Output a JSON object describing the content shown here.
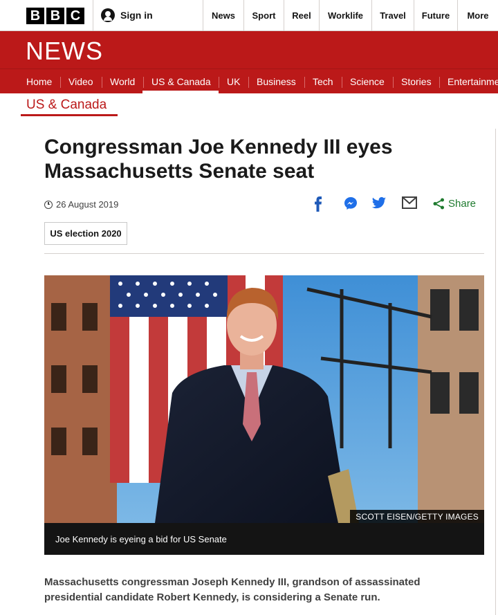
{
  "brand": {
    "letters": [
      "B",
      "B",
      "C"
    ]
  },
  "account": {
    "sign_in_label": "Sign in",
    "icon": "user-icon"
  },
  "top_nav": [
    "News",
    "Sport",
    "Reel",
    "Worklife",
    "Travel",
    "Future",
    "More"
  ],
  "news_banner": {
    "title": "NEWS",
    "color": "#bb1919"
  },
  "sub_nav": {
    "items": [
      "Home",
      "Video",
      "World",
      "US & Canada",
      "UK",
      "Business",
      "Tech",
      "Science",
      "Stories",
      "Entertainme"
    ],
    "active": "US & Canada"
  },
  "section": {
    "label": "US & Canada"
  },
  "article": {
    "headline_line1": "Congressman Joe Kennedy III eyes",
    "headline_line2": "Massachusetts Senate seat",
    "date": "26 August 2019",
    "tag": "US election 2020",
    "share": {
      "icons": [
        "facebook-icon",
        "messenger-icon",
        "twitter-icon",
        "email-icon",
        "share-icon"
      ],
      "label": "Share",
      "color": "#1e7a2e"
    },
    "image": {
      "credit": "SCOTT EISEN/GETTY IMAGES",
      "caption": "Joe Kennedy is eyeing a bid for US Senate"
    },
    "lead_line1": "Massachusetts congressman Joseph Kennedy III, grandson of assassinated",
    "lead_line2": "presidential candidate Robert Kennedy, is considering a Senate run."
  }
}
